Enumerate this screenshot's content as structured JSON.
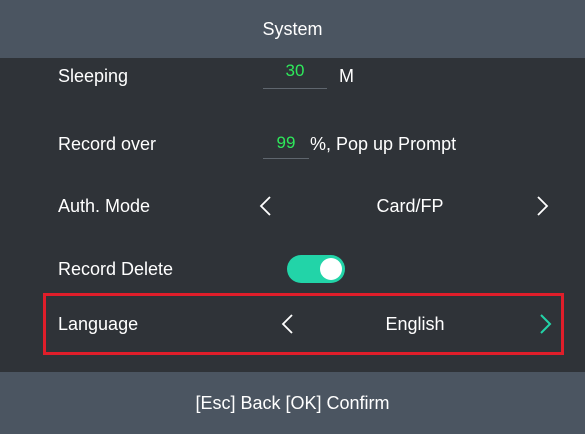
{
  "header": {
    "title": "System"
  },
  "settings": {
    "sleeping": {
      "label": "Sleeping",
      "value": "30",
      "unit": "M"
    },
    "record_over": {
      "label": "Record over",
      "value": "99",
      "suffix": "%, Pop up Prompt"
    },
    "auth_mode": {
      "label": "Auth. Mode",
      "value": "Card/FP",
      "prev_icon": "chevron-left-icon",
      "next_icon": "chevron-right-icon"
    },
    "record_delete": {
      "label": "Record Delete",
      "enabled": true
    },
    "language": {
      "label": "Language",
      "value": "English",
      "prev_icon": "chevron-left-icon",
      "next_icon": "chevron-right-icon"
    }
  },
  "footer": {
    "hint": "[Esc] Back [OK] Confirm"
  },
  "colors": {
    "header_bg": "#4b5561",
    "body_bg": "#2f3338",
    "value_green": "#2ee85b",
    "toggle_on": "#22d4a8",
    "highlight_border": "#e01e2a",
    "active_arrow": "#22d4a8"
  }
}
